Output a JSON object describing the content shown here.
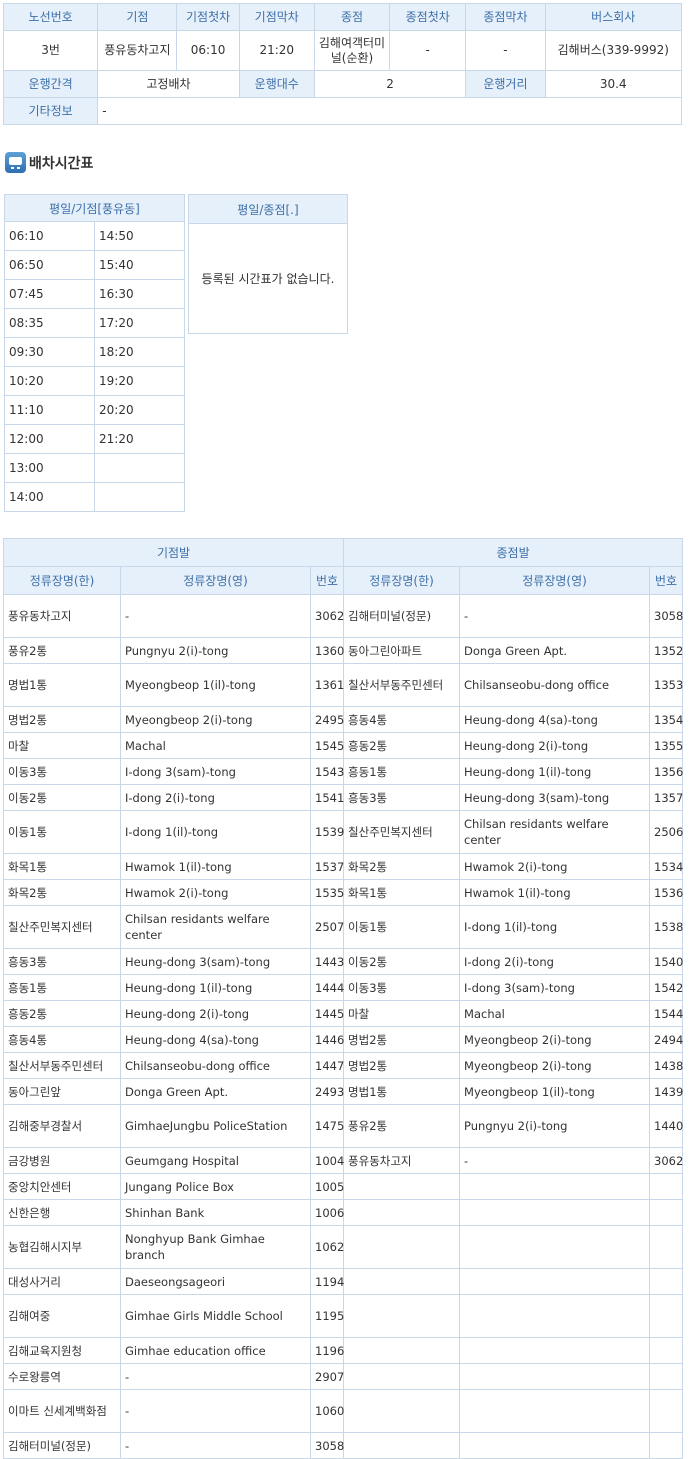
{
  "route_info": {
    "headers": [
      "노선번호",
      "기점",
      "기점첫차",
      "기점막차",
      "종점",
      "종점첫차",
      "종점막차",
      "버스회사"
    ],
    "values": [
      "3번",
      "풍유동차고지",
      "06:10",
      "21:20",
      "김해여객터미널(순환)",
      "-",
      "-",
      "김해버스(339-9992)"
    ],
    "interval_label": "운행간격",
    "interval_value": "고정배차",
    "bus_count_label": "운행대수",
    "bus_count_value": "2",
    "distance_label": "운행거리",
    "distance_value": "30.4",
    "etc_label": "기타정보",
    "etc_value": "-"
  },
  "schedule": {
    "title": "배차시간표",
    "icon": "bus-icon",
    "origin_header": "평일/기점[풍유동]",
    "origin_col1": [
      "06:10",
      "06:50",
      "07:45",
      "08:35",
      "09:30",
      "10:20",
      "11:10",
      "12:00",
      "13:00",
      "14:00"
    ],
    "origin_col2": [
      "14:50",
      "15:40",
      "16:30",
      "17:20",
      "18:20",
      "19:20",
      "20:20",
      "21:20",
      "",
      ""
    ],
    "terminal_header": "평일/종점[.]",
    "terminal_empty": "등록된 시간표가 없습니다."
  },
  "stops": {
    "origin_header": "기점발",
    "terminal_header": "종점발",
    "col_headers": [
      "정류장명(한)",
      "정류장명(영)",
      "번호",
      "정류장명(한)",
      "정류장명(영)",
      "번호"
    ],
    "rows": [
      [
        "풍유동차고지",
        "-",
        "3062",
        "김해터미널(정문)",
        "-",
        "3058"
      ],
      [
        "풍유2통",
        "Pungnyu 2(i)-tong",
        "1360",
        "동아그린아파트",
        "Donga Green Apt.",
        "1352"
      ],
      [
        "명법1통",
        "Myeongbeop 1(il)-tong",
        "1361",
        "칠산서부동주민센터",
        "Chilsanseobu-dong office",
        "1353"
      ],
      [
        "명법2통",
        "Myeongbeop 2(i)-tong",
        "2495",
        "흥동4통",
        "Heung-dong 4(sa)-tong",
        "1354"
      ],
      [
        "마찰",
        "Machal",
        "1545",
        "흥동2통",
        "Heung-dong 2(i)-tong",
        "1355"
      ],
      [
        "이동3통",
        "I-dong 3(sam)-tong",
        "1543",
        "흥동1통",
        "Heung-dong 1(il)-tong",
        "1356"
      ],
      [
        "이동2통",
        "I-dong 2(i)-tong",
        "1541",
        "흥동3통",
        "Heung-dong 3(sam)-tong",
        "1357"
      ],
      [
        "이동1통",
        "I-dong 1(il)-tong",
        "1539",
        "칠산주민복지센터",
        "Chilsan residants welfare center",
        "2506"
      ],
      [
        "화목1통",
        "Hwamok 1(il)-tong",
        "1537",
        "화목2통",
        "Hwamok 2(i)-tong",
        "1534"
      ],
      [
        "화목2통",
        "Hwamok 2(i)-tong",
        "1535",
        "화목1통",
        "Hwamok 1(il)-tong",
        "1536"
      ],
      [
        "칠산주민복지센터",
        "Chilsan residants welfare center",
        "2507",
        "이동1통",
        "I-dong 1(il)-tong",
        "1538"
      ],
      [
        "흥동3통",
        "Heung-dong 3(sam)-tong",
        "1443",
        "이동2통",
        "I-dong 2(i)-tong",
        "1540"
      ],
      [
        "흥동1통",
        "Heung-dong 1(il)-tong",
        "1444",
        "이동3통",
        "I-dong 3(sam)-tong",
        "1542"
      ],
      [
        "흥동2통",
        "Heung-dong 2(i)-tong",
        "1445",
        "마찰",
        "Machal",
        "1544"
      ],
      [
        "흥동4통",
        "Heung-dong 4(sa)-tong",
        "1446",
        "명법2통",
        "Myeongbeop 2(i)-tong",
        "2494"
      ],
      [
        "칠산서부동주민센터",
        "Chilsanseobu-dong office",
        "1447",
        "명법2통",
        "Myeongbeop 2(i)-tong",
        "1438"
      ],
      [
        "동아그린앞",
        "Donga Green Apt.",
        "2493",
        "명법1통",
        "Myeongbeop 1(il)-tong",
        "1439"
      ],
      [
        "김해중부경찰서",
        "GimhaeJungbu PoliceStation",
        "1475",
        "풍유2통",
        "Pungnyu 2(i)-tong",
        "1440"
      ],
      [
        "금강병원",
        "Geumgang Hospital",
        "1004",
        "풍유동차고지",
        "-",
        "3062"
      ],
      [
        "중앙치안센터",
        "Jungang Police Box",
        "1005",
        "",
        "",
        ""
      ],
      [
        "신한은행",
        "Shinhan Bank",
        "1006",
        "",
        "",
        ""
      ],
      [
        "농협김해시지부",
        "Nonghyup Bank Gimhae branch",
        "1062",
        "",
        "",
        ""
      ],
      [
        "대성사거리",
        "Daeseongsageori",
        "1194",
        "",
        "",
        ""
      ],
      [
        "김해여중",
        "Gimhae Girls Middle School",
        "1195",
        "",
        "",
        ""
      ],
      [
        "김해교육지원청",
        "Gimhae education office",
        "1196",
        "",
        "",
        ""
      ],
      [
        "수로왕릉역",
        "-",
        "2907",
        "",
        "",
        ""
      ],
      [
        "이마트 신세계백화점",
        "-",
        "1060",
        "",
        "",
        ""
      ],
      [
        "김해터미널(정문)",
        "-",
        "3058",
        "",
        "",
        ""
      ]
    ]
  }
}
